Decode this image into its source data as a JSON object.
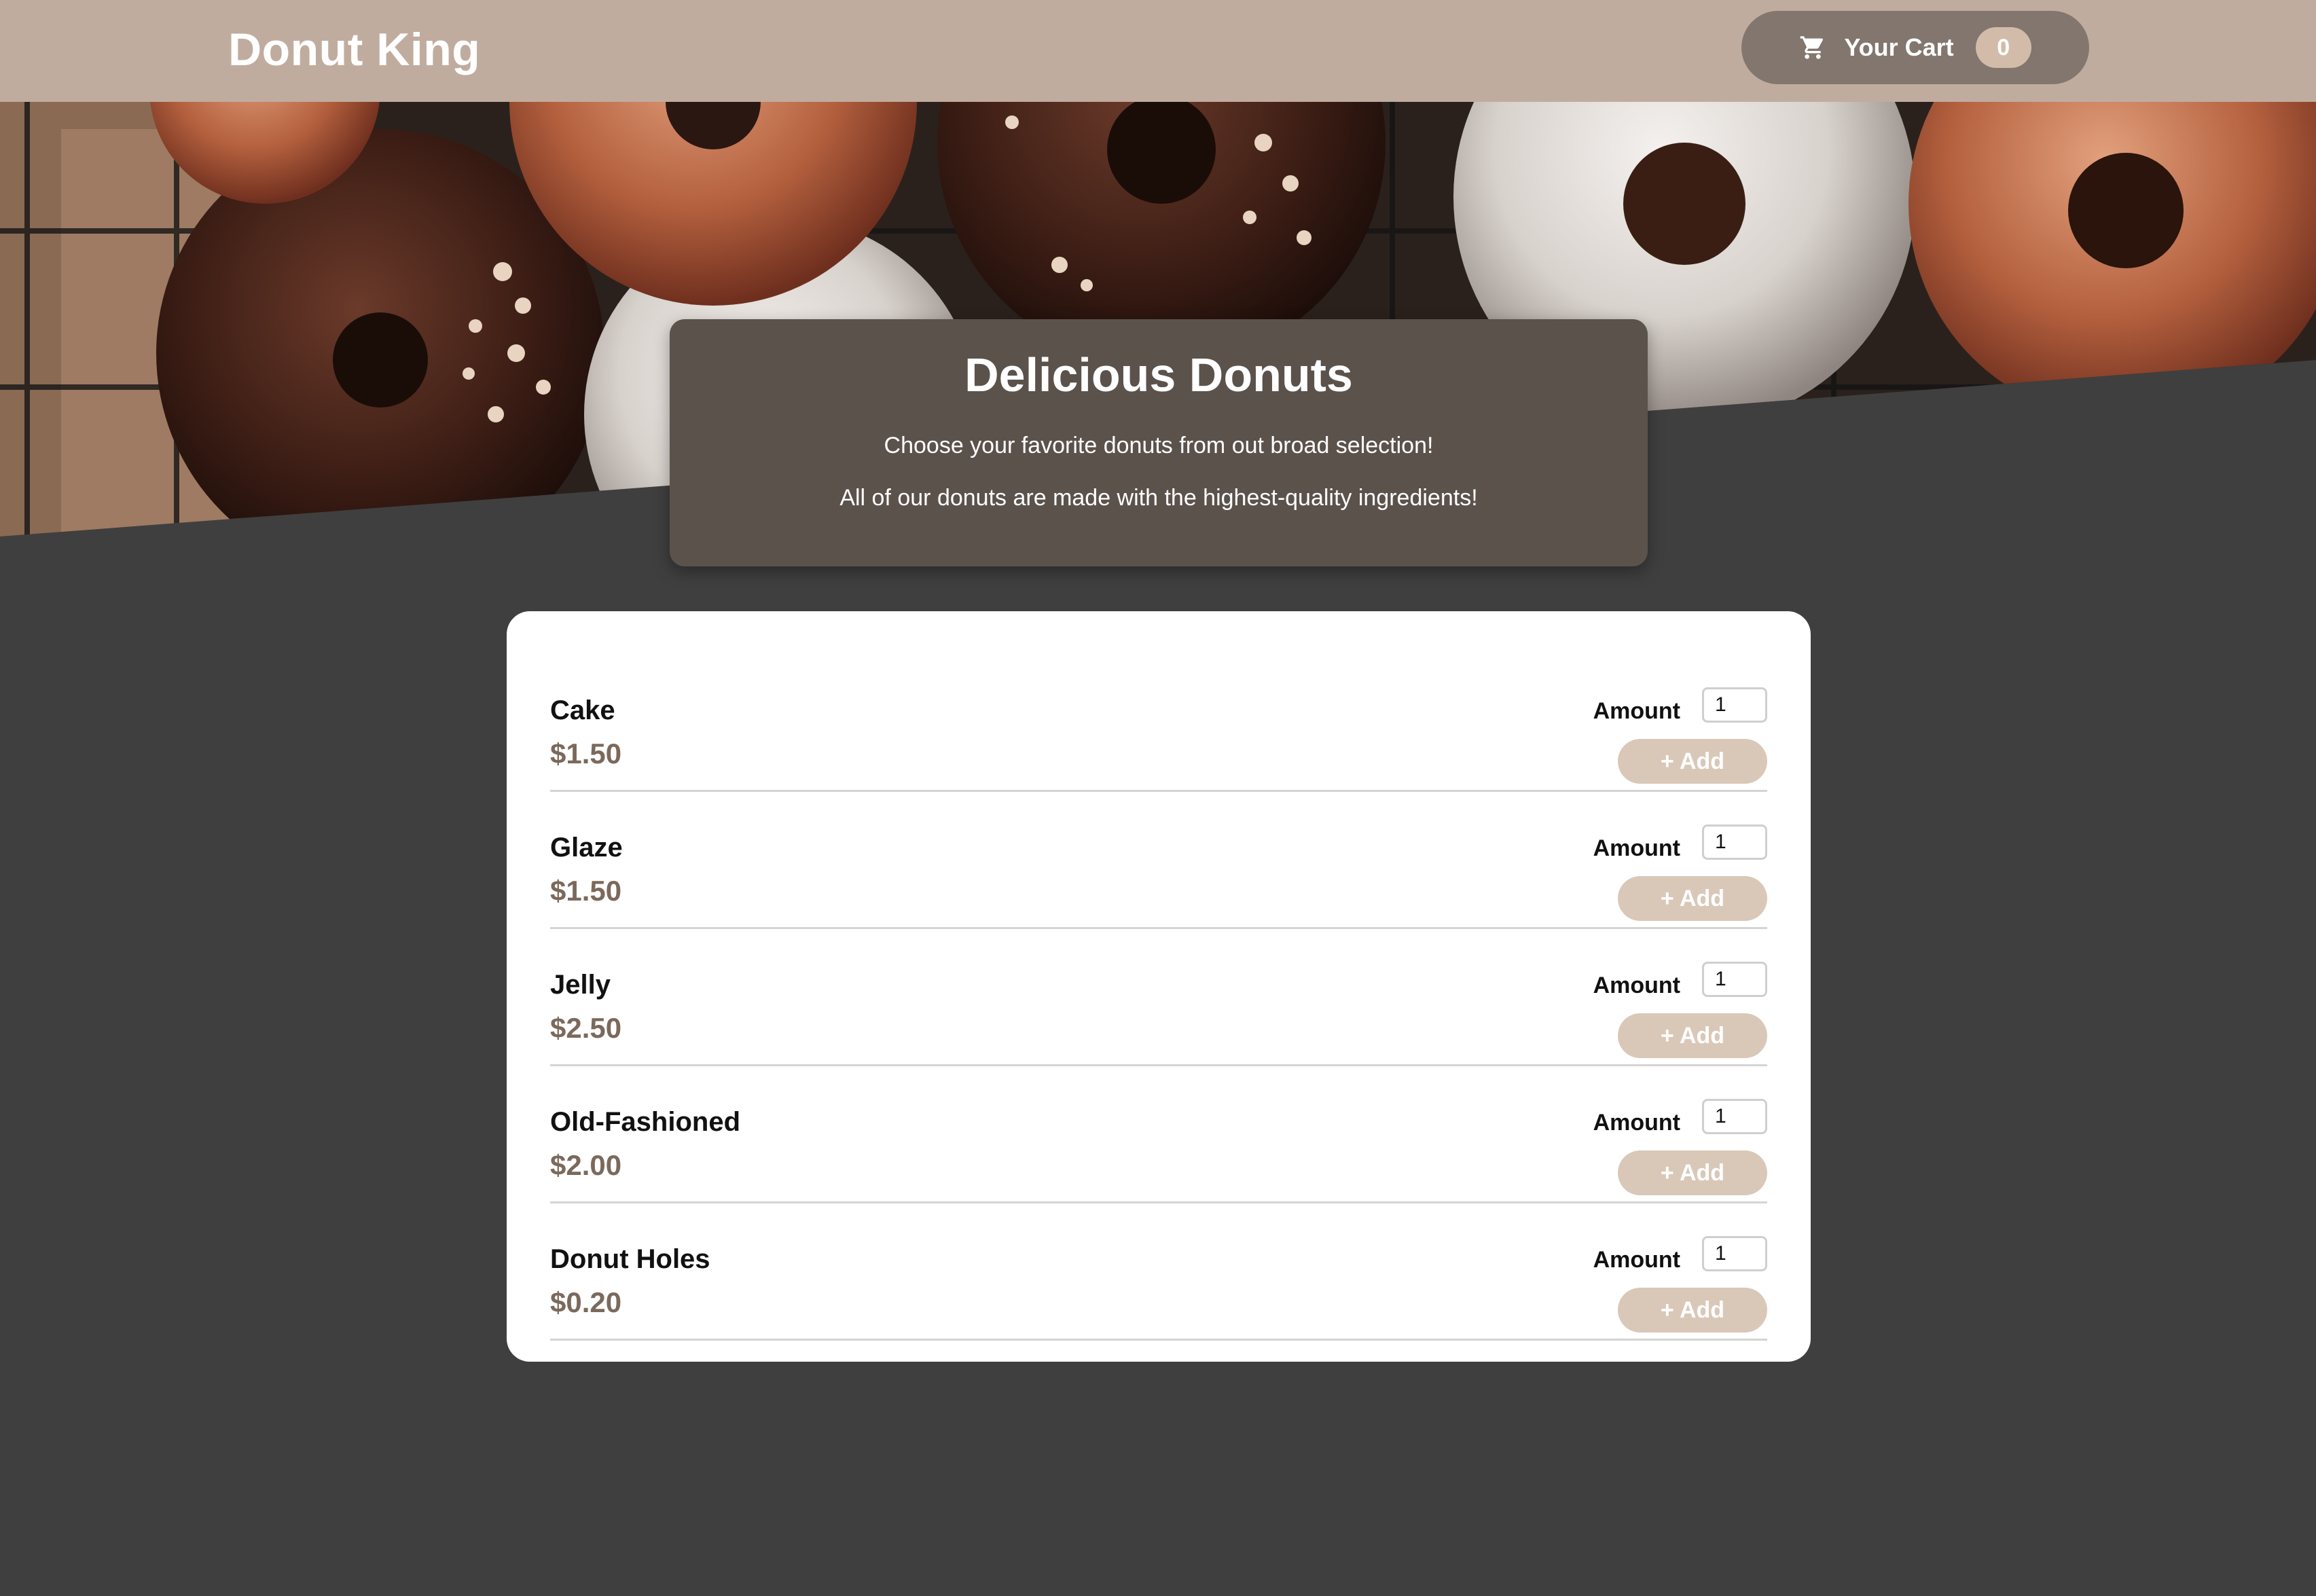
{
  "header": {
    "brand": "Donut King",
    "cart": {
      "label": "Your Cart",
      "count": "0",
      "icon": "cart-icon"
    }
  },
  "intro": {
    "title": "Delicious Donuts",
    "lines": [
      "Choose your favorite donuts from out broad selection!",
      "All of our donuts are made with the highest-quality ingredients!"
    ]
  },
  "menu": {
    "items": [
      {
        "name": "Cake",
        "price": "$1.50",
        "amount_label": "Amount",
        "amount": "1",
        "add_label": "+ Add"
      },
      {
        "name": "Glaze",
        "price": "$1.50",
        "amount_label": "Amount",
        "amount": "1",
        "add_label": "+ Add"
      },
      {
        "name": "Jelly",
        "price": "$2.50",
        "amount_label": "Amount",
        "amount": "1",
        "add_label": "+ Add"
      },
      {
        "name": "Old-Fashioned",
        "price": "$2.00",
        "amount_label": "Amount",
        "amount": "1",
        "add_label": "+ Add"
      },
      {
        "name": "Donut Holes",
        "price": "$0.20",
        "amount_label": "Amount",
        "amount": "1",
        "add_label": "+ Add"
      }
    ]
  },
  "colors": {
    "header_bg": "#c0ac9e",
    "page_bg": "#3f3f3f",
    "cart_button": "#82766e",
    "cart_badge": "#d2bca9",
    "intro_card": "#5b524c",
    "price_text": "#7b695b",
    "add_button": "#d9c8b8"
  }
}
